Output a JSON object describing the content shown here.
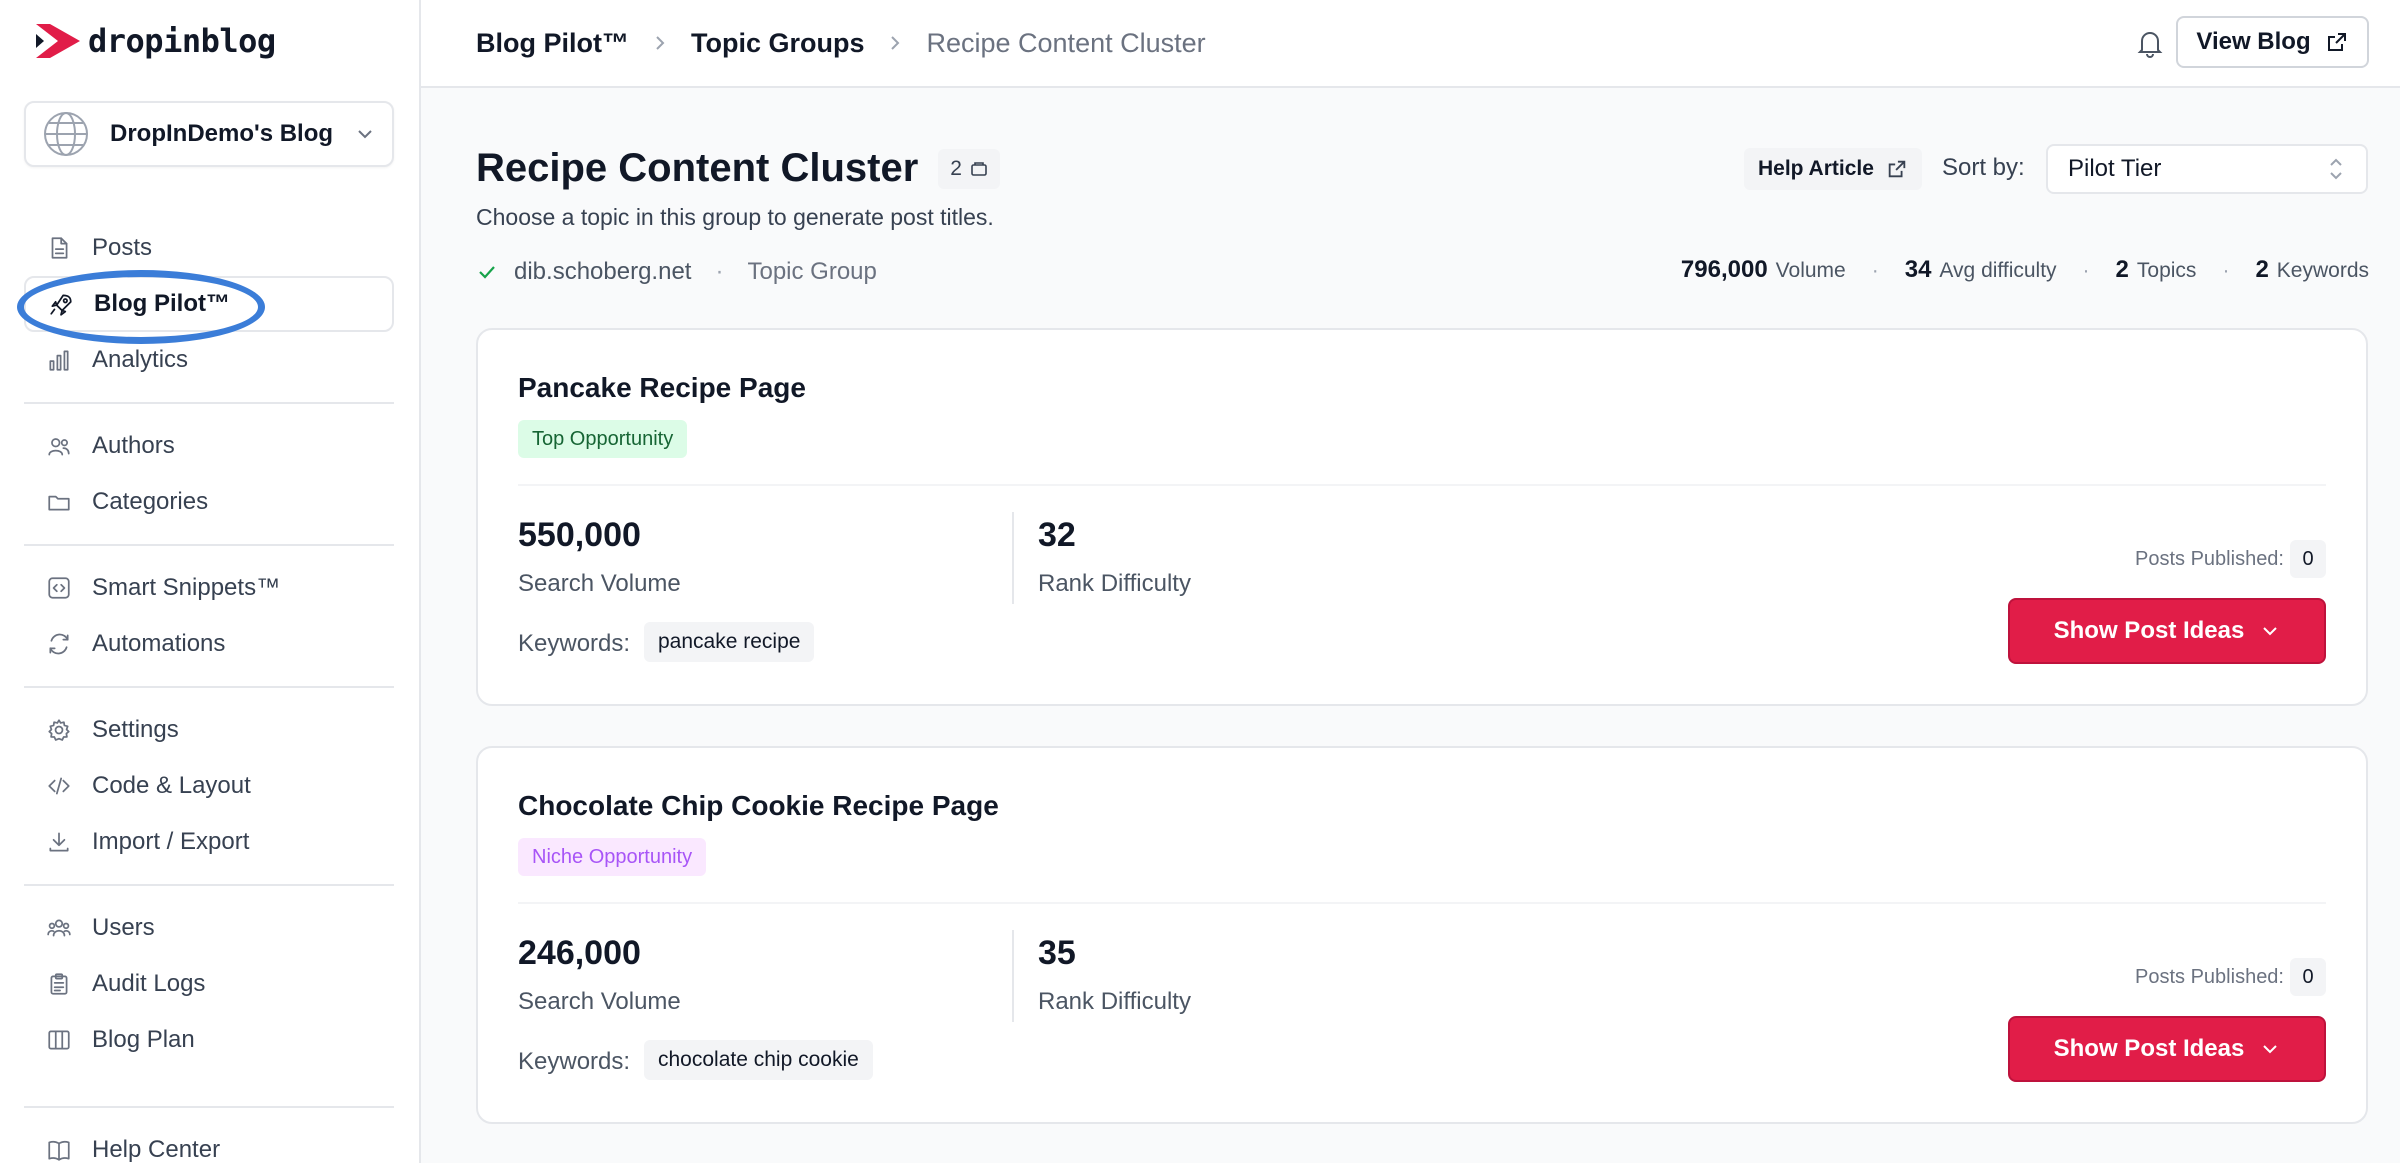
{
  "brand": {
    "name": "dropinblog",
    "accent": "#e11d48"
  },
  "blog_selector": {
    "name": "DropInDemo's Blog"
  },
  "sidebar": {
    "groups": [
      [
        {
          "label": "Posts",
          "icon": "document-icon"
        },
        {
          "label": "Blog Pilot™",
          "icon": "rocket-icon",
          "active": true
        },
        {
          "label": "Analytics",
          "icon": "bar-chart-icon"
        }
      ],
      [
        {
          "label": "Authors",
          "icon": "users-icon"
        },
        {
          "label": "Categories",
          "icon": "folder-icon"
        }
      ],
      [
        {
          "label": "Smart Snippets™",
          "icon": "code-square-icon"
        },
        {
          "label": "Automations",
          "icon": "refresh-icon"
        }
      ],
      [
        {
          "label": "Settings",
          "icon": "gear-icon"
        },
        {
          "label": "Code & Layout",
          "icon": "code-icon"
        },
        {
          "label": "Import / Export",
          "icon": "download-icon"
        }
      ],
      [
        {
          "label": "Users",
          "icon": "user-group-icon"
        },
        {
          "label": "Audit Logs",
          "icon": "clipboard-icon"
        },
        {
          "label": "Blog Plan",
          "icon": "columns-icon"
        }
      ],
      [
        {
          "label": "Help Center",
          "icon": "book-icon"
        }
      ]
    ]
  },
  "header": {
    "breadcrumbs": [
      "Blog Pilot™",
      "Topic Groups",
      "Recipe Content Cluster"
    ],
    "view_blog": "View Blog"
  },
  "page": {
    "title": "Recipe Content Cluster",
    "topic_count": "2",
    "subtitle": "Choose a topic in this group to generate post titles.",
    "domain": "dib.schoberg.net",
    "type": "Topic Group",
    "help_article": "Help Article",
    "sort_label": "Sort by:",
    "sort_value": "Pilot Tier",
    "stats": {
      "volume": "796,000",
      "volume_label": "Volume",
      "difficulty": "34",
      "difficulty_label": "Avg difficulty",
      "topics": "2",
      "topics_label": "Topics",
      "keywords": "2",
      "keywords_label": "Keywords"
    }
  },
  "topics": [
    {
      "title": "Pancake Recipe Page",
      "tag": "Top Opportunity",
      "tag_bg": "#dcfce7",
      "tag_color": "#166534",
      "volume": "550,000",
      "volume_label": "Search Volume",
      "difficulty": "32",
      "difficulty_label": "Rank Difficulty",
      "keywords_label": "Keywords:",
      "keyword": "pancake recipe",
      "posts_published_label": "Posts Published:",
      "posts_published": "0",
      "button": "Show Post Ideas"
    },
    {
      "title": "Chocolate Chip Cookie Recipe Page",
      "tag": "Niche Opportunity",
      "tag_bg": "#fae8ff",
      "tag_color": "#a855f7",
      "volume": "246,000",
      "volume_label": "Search Volume",
      "difficulty": "35",
      "difficulty_label": "Rank Difficulty",
      "keywords_label": "Keywords:",
      "keyword": "chocolate chip cookie",
      "posts_published_label": "Posts Published:",
      "posts_published": "0",
      "button": "Show Post Ideas"
    }
  ]
}
